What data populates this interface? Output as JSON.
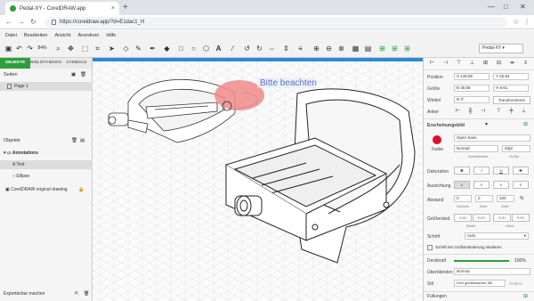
{
  "browser": {
    "tab_title": "Pedal-XY - CorelDRAW.app",
    "url": "https://coreldraw.app/?d=E1dac1_H"
  },
  "menu": [
    "Datei",
    "Bearbeiten",
    "Ansicht",
    "Anordnen",
    "Hilfe"
  ],
  "toolbar": {
    "zoom": "84%",
    "page_label": "Pedal-XY"
  },
  "left_panel": {
    "tabs": [
      "OBJEKTE",
      "BIBLIOTHEKEN",
      "SYMBOLE"
    ],
    "pages_title": "Seiten",
    "page_item": "Page 1",
    "objects_title": "Objekte",
    "objects": [
      {
        "label": "Annotations",
        "selected": false
      },
      {
        "label": "Text",
        "selected": true
      },
      {
        "label": "Ellipse",
        "selected": false
      },
      {
        "label": "CorelDRAW original drawing",
        "selected": false
      }
    ],
    "export_label": "Exportierbar machen"
  },
  "canvas": {
    "annotation_text": "Bitte beachten",
    "annotation_color": "#f08a8a"
  },
  "right_panel": {
    "position_label": "Position",
    "pos_x": "149.55",
    "pos_y": "25.93",
    "size_label": "Größe",
    "size_w": "48.68",
    "size_h": "9.61",
    "angle_label": "Winkel",
    "angle_value": "0°",
    "transform_btn": "Transformieren",
    "anchor_label": "Anker",
    "appearance_title": "Erscheinungsbild",
    "font_name": "Open Sans",
    "font_style": "Normal",
    "font_size": "20pt",
    "color_label": "Farbe",
    "font_sub1": "Schriftstärke",
    "font_sub2": "Größe",
    "decoration_label": "Dekoration",
    "align_label": "Ausrichtung",
    "spacing_label": "Abstand",
    "spacing_values": [
      "0",
      "0",
      "100",
      "%"
    ],
    "spacing_subs": [
      "Zeichen",
      "Wort",
      "Zeile"
    ],
    "resize_label": "Größenänd.",
    "resize_opts": [
      "Auto",
      "Kein",
      "Auto",
      "Kein"
    ],
    "resize_subs": [
      "Breite",
      "Höhe"
    ],
    "font_label": "Schrift",
    "font_auto": "Auto",
    "scale_check": "Schrift bei Größenänderung skalieren",
    "opacity_label": "Deckkraft",
    "opacity_value": "100%",
    "overlay_label": "Überblenden",
    "overlay_value": "Normal",
    "style_label": "Stil",
    "style_value": "Kein gemeinsamer Stil",
    "style_btn": "Ändern",
    "fill_label": "Füllungen",
    "accent": "#2e9e3c",
    "text_color": "#e0102a"
  }
}
